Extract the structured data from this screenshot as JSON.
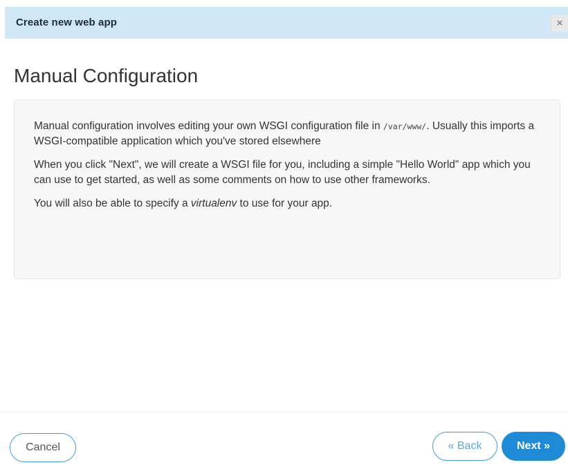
{
  "dialog": {
    "title": "Create new web app",
    "close_glyph": "×",
    "close_icon": "close-icon"
  },
  "main": {
    "heading": "Manual Configuration",
    "paragraphs": [
      {
        "text_before": "Manual configuration involves editing your own WSGI configuration file in ",
        "code": "/var/www/",
        "text_after": ". Usually this imports a WSGI-compatible application which you've stored elsewhere"
      },
      {
        "text": "When you click \"Next\", we will create a WSGI file for you, including a simple \"Hello World\" app which you can use to get started, as well as some comments on how to use other frameworks."
      },
      {
        "text_before": "You will also be able to specify a ",
        "emphasis": "virtualenv",
        "text_after": " to use for your app."
      }
    ]
  },
  "footer": {
    "cancel_label": "Cancel",
    "back_label": "« Back",
    "next_label": "Next »"
  },
  "colors": {
    "header_bg": "#cfe7f7",
    "accent": "#1f8ad6",
    "button_border": "#3f9ed8"
  }
}
